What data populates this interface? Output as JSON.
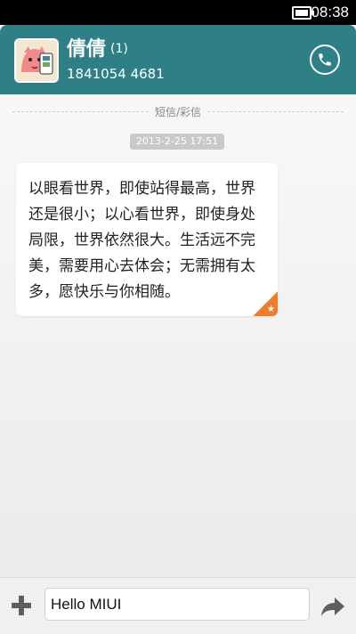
{
  "status_bar": {
    "time": "08:38",
    "battery_level": 1.0,
    "icons": [
      "battery-icon"
    ]
  },
  "header": {
    "contact_name": "倩倩",
    "unread_count": "(1)",
    "phone_number": "1841054 4681",
    "icons": [
      "avatar-image",
      "phone-icon"
    ],
    "accent_color": "#2e7f86"
  },
  "conversation": {
    "message_type": "短信/彩信",
    "timestamp": "2013-2-25 17:51",
    "messages": [
      {
        "text": "以眼看世界，即使站得最高，世界还是很小；以心看世界，即使身处局限，世界依然很大。生活远不完美，需要用心去体会；无需拥有太多，愿快乐与你相随。",
        "starred": true,
        "star_icon": "star-icon",
        "star_color": "#ee7d2b"
      }
    ]
  },
  "composer": {
    "input_value": "Hello MIUI",
    "icons": [
      "plus-icon",
      "send-icon"
    ]
  }
}
